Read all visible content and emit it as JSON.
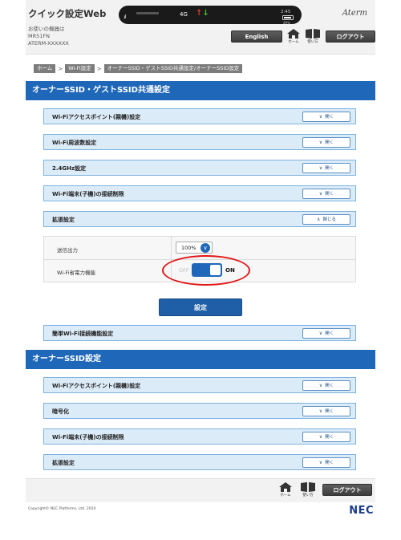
{
  "header": {
    "app_title": "クイック設定Web",
    "device_label_line1": "お使いの機器は",
    "device_label_line2": "MR51FN",
    "device_label_line3": "ATERM-XXXXXX",
    "status": {
      "network": "4G",
      "clock": "2:45",
      "battery": "49%"
    },
    "brand": "Aterm",
    "english_label": "English",
    "home_label": "ホーム",
    "help_label": "使い方",
    "logout_label": "ログアウト"
  },
  "breadcrumb": [
    "ホーム",
    "Wi-Fi設定",
    "オーナーSSID・ゲストSSID共通設定/オーナーSSID設定"
  ],
  "section1": {
    "title": "オーナーSSID・ゲストSSID共通設定",
    "items": [
      {
        "label": "Wi-Fiアクセスポイント(親機)設定",
        "button": "開く"
      },
      {
        "label": "Wi-Fi周波数設定",
        "button": "開く"
      },
      {
        "label": "2.4GHz設定",
        "button": "開く"
      },
      {
        "label": "Wi-Fi端末(子機)の接続制限",
        "button": "開く"
      },
      {
        "label": "拡張設定",
        "button": "閉じる"
      }
    ],
    "extended": {
      "tx_power_label": "送信出力",
      "tx_power_value": "100%",
      "power_save_label": "Wi-Fi省電力機能",
      "toggle_off": "OFF",
      "toggle_on": "ON",
      "toggle_state": "on"
    },
    "set_button": "設定",
    "easy_connect": {
      "label": "簡単Wi-Fi接続機能設定",
      "button": "開く"
    }
  },
  "section2": {
    "title": "オーナーSSID設定",
    "items": [
      {
        "label": "Wi-Fiアクセスポイント(親機)設定",
        "button": "開く"
      },
      {
        "label": "暗号化",
        "button": "開く"
      },
      {
        "label": "Wi-Fi端末(子機)の接続制限",
        "button": "開く"
      },
      {
        "label": "拡張設定",
        "button": "開く"
      }
    ]
  },
  "footer": {
    "home_label": "ホーム",
    "help_label": "使い方",
    "logout_label": "ログアウト",
    "copyright": "Copyright© NEC Platforms, Ltd. 2024",
    "logo": "NEC"
  },
  "colors": {
    "accent": "#1f67b8",
    "highlight": "#e11818",
    "accordion_bg": "#dcebf8"
  }
}
